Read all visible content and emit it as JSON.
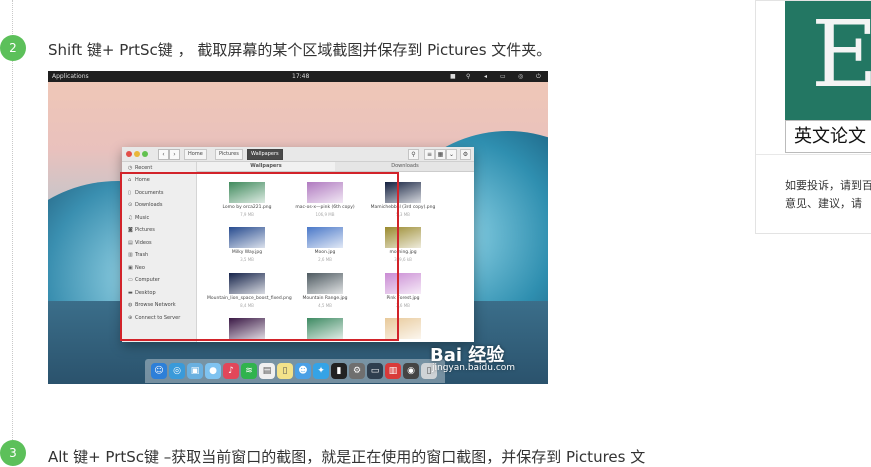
{
  "steps": [
    {
      "number": "2",
      "text": "Shift 键+ PrtSc键 ， 截取屏幕的某个区域截图并保存到 Pictures 文件夹。"
    },
    {
      "number": "3",
      "text": "Alt 键+ PrtSc键 –获取当前窗口的截图，就是正在使用的窗口截图，并保存到 Pictures 文"
    }
  ],
  "screenshot": {
    "topbar": {
      "apps": "Applications",
      "clock": "17:48"
    },
    "file_manager": {
      "breadcrumbs": [
        "Home",
        "Pictures",
        "Wallpapers"
      ],
      "sidebar": [
        "Recent",
        "Home",
        "Documents",
        "Downloads",
        "Music",
        "Pictures",
        "Videos",
        "Trash",
        "Neo",
        "Computer",
        "Desktop",
        "Browse Network",
        "Connect to Server"
      ],
      "tabs": [
        "Wallpapers",
        "Downloads"
      ],
      "files": [
        {
          "name": "Lomo by orca221.png",
          "size": "7,9 MB",
          "color": "#3f8a5c"
        },
        {
          "name": "mac-os-x—pink (6th copy)",
          "size": "106,9 MB",
          "color": "#b07ac0"
        },
        {
          "name": "Mamichebbal (3rd copy).png",
          "size": "5,3 MB",
          "color": "#13203f"
        },
        {
          "name": "Milky Way.jpg",
          "size": "3,5 MB",
          "color": "#274b8f"
        },
        {
          "name": "Moon.jpg",
          "size": "2,6 MB",
          "color": "#4a78c8"
        },
        {
          "name": "morning.jpg",
          "size": "389,6 kB",
          "color": "#9a8a2e"
        },
        {
          "name": "Mountain_lion_space_boost_fixed.png",
          "size": "8,4 MB",
          "color": "#15234a"
        },
        {
          "name": "Mountain Range.jpg",
          "size": "4,5 MB",
          "color": "#4d5960"
        },
        {
          "name": "Pink Forest.jpg",
          "size": "2,6 MB",
          "color": "#c98ad3"
        },
        {
          "name": "",
          "size": "",
          "color": "#3a1845"
        },
        {
          "name": "",
          "size": "",
          "color": "#3d8a62"
        },
        {
          "name": "",
          "size": "",
          "color": "#e8c99a"
        }
      ]
    },
    "watermark": {
      "brand": "Bai 经验",
      "url": "jingyan.baidu.com"
    }
  },
  "sidebar_panel": {
    "book_letter": "Eg",
    "book_title": "英文论文",
    "notice_line1": "如要投诉，请到百",
    "notice_line2": "意见、建议，请"
  },
  "colors": {
    "step_badge": "#5cc05a",
    "selection_border": "#d2232a",
    "book_cover": "#237763"
  }
}
